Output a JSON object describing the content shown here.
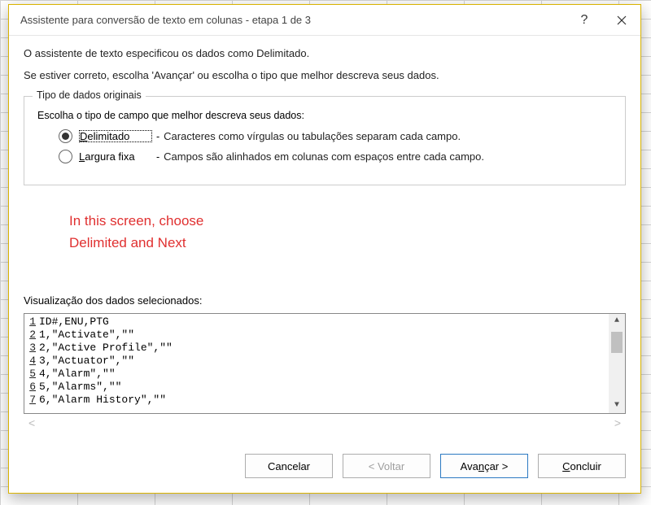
{
  "titlebar": {
    "title": "Assistente para conversão de texto em colunas - etapa 1 de 3"
  },
  "intro1": "O assistente de texto especificou os dados como Delimitado.",
  "intro2": "Se estiver correto, escolha 'Avançar' ou escolha o tipo que melhor descreva seus dados.",
  "fieldset": {
    "legend": "Tipo de dados originais",
    "prompt": "Escolha o tipo de campo que melhor descreva seus dados:",
    "option1": {
      "label_pre": "D",
      "label_rest": "elimitado",
      "desc": "Caracteres como vírgulas ou tabulações separam cada campo."
    },
    "option2": {
      "label_pre": "L",
      "label_rest": "argura fixa",
      "desc": "Campos são alinhados em colunas com espaços entre cada campo."
    }
  },
  "annotation": {
    "line1": "In this screen, choose",
    "line2": "Delimited and Next"
  },
  "preview": {
    "label": "Visualização dos dados selecionados:",
    "rows": [
      {
        "n": "1",
        "text": "ID#,ENU,PTG"
      },
      {
        "n": "2",
        "text": "1,\"Activate\",\"\""
      },
      {
        "n": "3",
        "text": "2,\"Active Profile\",\"\""
      },
      {
        "n": "4",
        "text": "3,\"Actuator\",\"\""
      },
      {
        "n": "5",
        "text": "4,\"Alarm\",\"\""
      },
      {
        "n": "6",
        "text": "5,\"Alarms\",\"\""
      },
      {
        "n": "7",
        "text": "6,\"Alarm History\",\"\""
      }
    ]
  },
  "buttons": {
    "cancel": "Cancelar",
    "back": "< Voltar",
    "next_pre": "Ava",
    "next_u": "n",
    "next_post": "çar >",
    "finish_pre": "",
    "finish_u": "C",
    "finish_post": "oncluir"
  }
}
